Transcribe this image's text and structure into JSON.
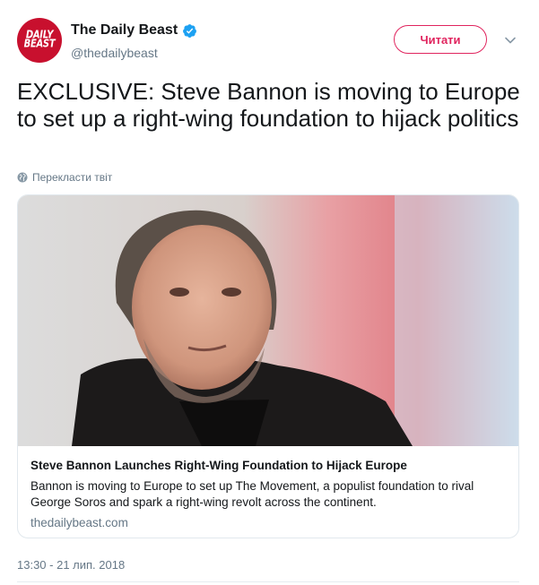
{
  "account": {
    "avatar_line1": "DAILY",
    "avatar_line2": "BEAST",
    "display_name": "The Daily Beast",
    "handle": "@thedailybeast",
    "verified": true
  },
  "actions": {
    "follow_label": "Читати"
  },
  "tweet": {
    "text": "EXCLUSIVE: Steve Bannon is moving to Europe to set up a right-wing foundation to hijack politics",
    "translate_label": "Перекласти твіт",
    "timestamp": "13:30 - 21 лип. 2018"
  },
  "card": {
    "title": "Steve Bannon Launches Right-Wing Foundation to Hijack Europe",
    "description": "Bannon is moving to Europe to set up The Movement, a populist foundation to rival George Soros and spark a right-wing revolt across the continent.",
    "domain": "thedailybeast.com"
  },
  "colors": {
    "accent": "#e0245e",
    "verified": "#1da1f2",
    "brand": "#c8102e",
    "muted": "#657786"
  },
  "icons": {
    "verified": "verified-badge-icon",
    "menu": "chevron-down-icon",
    "translate": "globe-icon"
  }
}
